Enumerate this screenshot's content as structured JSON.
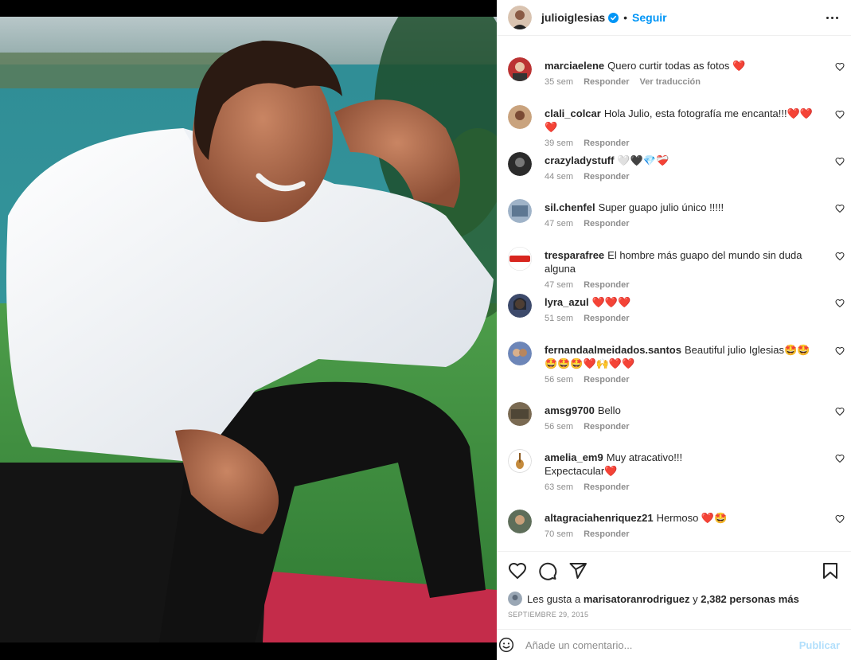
{
  "post": {
    "author": {
      "username": "julioiglesias",
      "verified": true,
      "follow_label": "Seguir",
      "separator": "•"
    },
    "comments": [
      {
        "username": "marciaelene",
        "text": "Quero curtir todas as fotos ❤️",
        "time": "35 sem",
        "reply": "Responder",
        "translate": "Ver traducción"
      },
      {
        "username": "clali_colcar",
        "text": "Hola Julio, esta fotografía me encanta!!!❤️❤️❤️",
        "time": "39 sem",
        "reply": "Responder"
      },
      {
        "username": "crazyladystuff",
        "text": "🤍🖤💎❤️‍🩹",
        "time": "44 sem",
        "reply": "Responder"
      },
      {
        "username": "sil.chenfel",
        "text": "Super guapo julio único !!!!!",
        "time": "47 sem",
        "reply": "Responder"
      },
      {
        "username": "tresparafree",
        "text": "El hombre más guapo del mundo sin duda alguna",
        "time": "47 sem",
        "reply": "Responder"
      },
      {
        "username": "lyra_azul",
        "text": "❤️❤️❤️",
        "time": "51 sem",
        "reply": "Responder"
      },
      {
        "username": "fernandaalmeidados.santos",
        "text": "Beautiful julio Iglesias🤩🤩🤩🤩🤩❤️🙌❤️❤️",
        "time": "56 sem",
        "reply": "Responder"
      },
      {
        "username": "amsg9700",
        "text": "Bello",
        "time": "56 sem",
        "reply": "Responder"
      },
      {
        "username": "amelia_em9",
        "text": "Muy atracativo!!!\nExpectacular❤️",
        "time": "63 sem",
        "reply": "Responder"
      },
      {
        "username": "altagraciahenriquez21",
        "text": "Hermoso ❤️🤩",
        "time": "70 sem",
        "reply": "Responder"
      }
    ],
    "likes": {
      "prefix": "Les gusta a",
      "user": "marisatoranrodriguez",
      "connector": "y",
      "others": "2,382 personas más"
    },
    "date": "SEPTIEMBRE 29, 2015",
    "add_comment": {
      "placeholder": "Añade un comentario...",
      "publish_label": "Publicar"
    }
  },
  "icons": {
    "header": [
      "avatar",
      "verified-badge-icon",
      "more-options-icon"
    ],
    "actions": [
      "heart-icon",
      "comment-icon",
      "share-icon",
      "bookmark-icon"
    ],
    "input": [
      "emoji-icon"
    ]
  },
  "colors": {
    "accent": "#0095f6",
    "publish_disabled": "#b2dffc",
    "text": "#262626",
    "muted": "#8e8e8e",
    "border": "#efefef"
  }
}
